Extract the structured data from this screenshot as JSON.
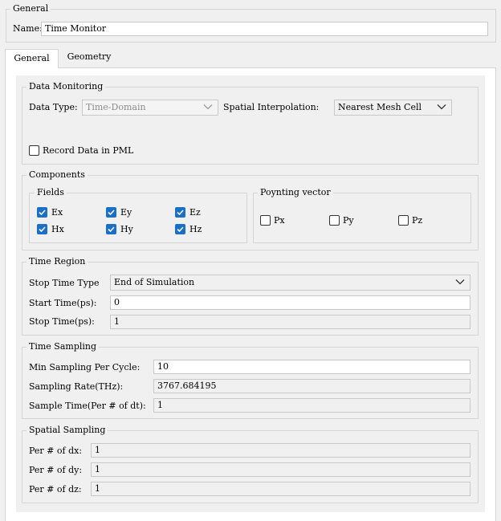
{
  "general_group": {
    "title": "General",
    "name_label": "Name:",
    "name_value": "Time Monitor"
  },
  "tabs": [
    {
      "label": "General",
      "active": true
    },
    {
      "label": "Geometry",
      "active": false
    }
  ],
  "data_monitoring": {
    "title": "Data Monitoring",
    "data_type_label": "Data Type:",
    "data_type_value": "Time-Domain",
    "spatial_interp_label": "Spatial Interpolation:",
    "spatial_interp_value": "Nearest Mesh Cell",
    "record_pml_label": "Record Data in PML",
    "record_pml_checked": false
  },
  "components": {
    "title": "Components",
    "fields": {
      "title": "Fields",
      "items": [
        {
          "label": "Ex",
          "checked": true
        },
        {
          "label": "Ey",
          "checked": true
        },
        {
          "label": "Ez",
          "checked": true
        },
        {
          "label": "Hx",
          "checked": true
        },
        {
          "label": "Hy",
          "checked": true
        },
        {
          "label": "Hz",
          "checked": true
        }
      ]
    },
    "poynting": {
      "title": "Poynting vector",
      "items": [
        {
          "label": "Px",
          "checked": false
        },
        {
          "label": "Py",
          "checked": false
        },
        {
          "label": "Pz",
          "checked": false
        }
      ]
    }
  },
  "time_region": {
    "title": "Time Region",
    "stop_type_label": "Stop Time Type",
    "stop_type_value": "End of Simulation",
    "start_label": "Start Time(ps):",
    "start_value": "0",
    "stop_label": "Stop Time(ps):",
    "stop_value": "1"
  },
  "time_sampling": {
    "title": "Time Sampling",
    "min_label": "Min Sampling Per Cycle:",
    "min_value": "10",
    "rate_label": "Sampling Rate(THz):",
    "rate_value": "3767.684195",
    "sample_label": "Sample Time(Per # of dt):",
    "sample_value": "1"
  },
  "spatial_sampling": {
    "title": "Spatial Sampling",
    "dx_label": "Per # of dx:",
    "dx_value": "1",
    "dy_label": "Per # of dy:",
    "dy_value": "1",
    "dz_label": "Per # of dz:",
    "dz_value": "1"
  }
}
